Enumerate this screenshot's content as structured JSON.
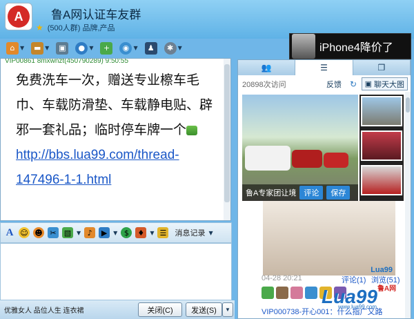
{
  "group": {
    "logo_text": "A",
    "name": "鲁A网认证车友群",
    "member_info": "(500人群) 品牌,产品"
  },
  "toolbar": {
    "icons": [
      "home-icon",
      "folder-icon",
      "album-icon",
      "chat-bubble-icon",
      "add-app-icon",
      "webcam-icon",
      "police-icon",
      "gear-icon"
    ]
  },
  "ad": {
    "text": "iPhone4降价了"
  },
  "chat": {
    "header": "VIP00861 8mxwnzt(450790289)  9:50:55",
    "message": "免费洗车一次，赠送专业檫车毛巾、车载防滑垫、车载静电贴、辟邪一套礼品；临时停车牌一个",
    "link": "http://bbs.lua99.com/thread-147496-1-1.html"
  },
  "format_bar": {
    "history_label": "消息记录"
  },
  "bottom": {
    "ad_text": "优雅女人 品位人生 连衣裙",
    "close_label": "关闭(C)",
    "send_label": "发送(S)"
  },
  "panel": {
    "visits": "20898次访问",
    "feedback": "反馈",
    "bigpic_label": "聊天大图",
    "caption": "鲁A专家团让境",
    "comment_btn": "评论",
    "save_btn": "保存",
    "date": "04-28 20:21",
    "comment_link": "评论(1)",
    "browse_link": "浏览(51)",
    "feed_line": "VIP000738-开心001：什么指广又路",
    "photo_brand": "Lua99"
  },
  "watermark": {
    "text": "Lua99",
    "suffix": "鲁A网",
    "domain": "www.lua99.com"
  },
  "colors": {
    "accent": "#1a57c7",
    "header_bg": "#6fb6e8",
    "brand_red": "#d42a26"
  }
}
